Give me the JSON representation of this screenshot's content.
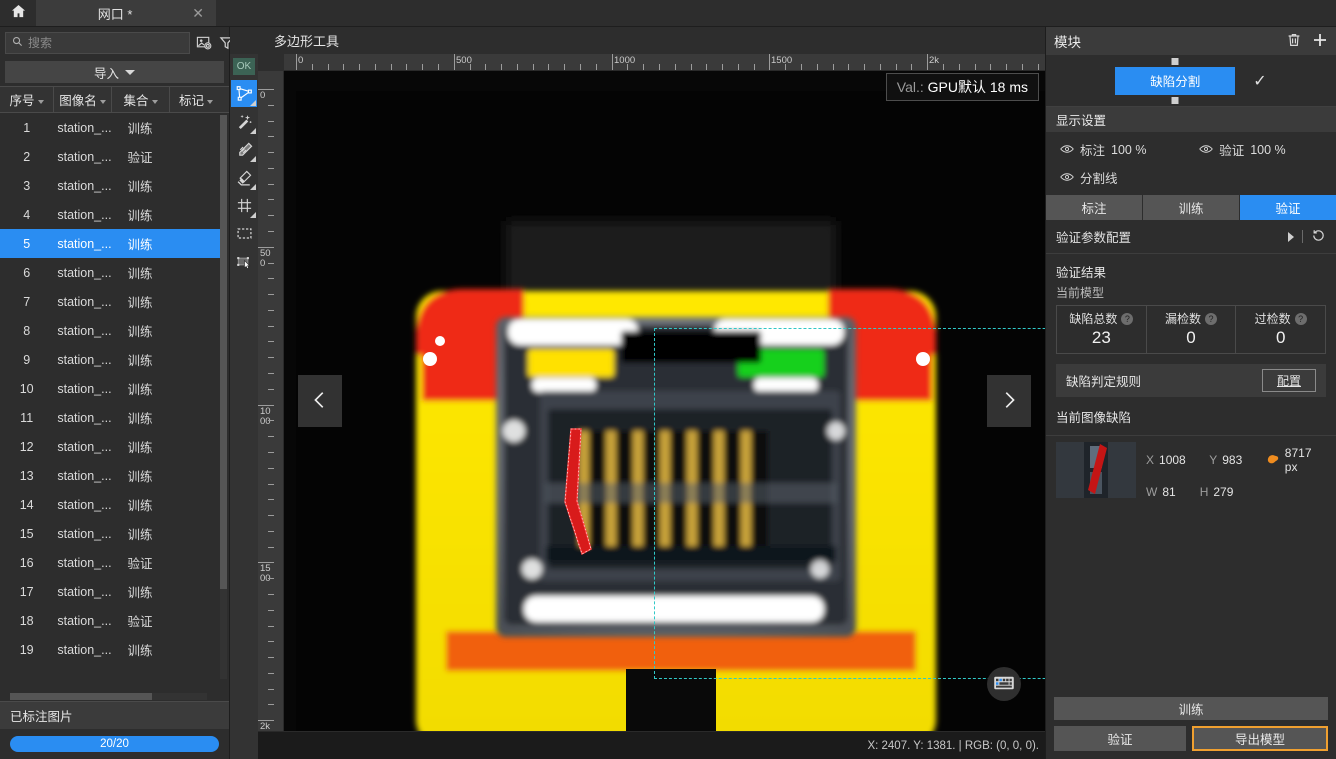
{
  "titlebar": {
    "home_icon": "home-icon",
    "tab_label": "网口 *",
    "tab_close": "✕"
  },
  "left_panel": {
    "search": {
      "placeholder": "搜索",
      "value": ""
    },
    "toolbar_icons": [
      "image-tag-icon",
      "filter-icon",
      "list-view-icon",
      "thumbnail-view-icon"
    ],
    "import_label": "导入",
    "columns": [
      "序号",
      "图像名",
      "集合",
      "标记"
    ],
    "rows": [
      {
        "idx": "1",
        "name": "station_...",
        "set": "训练",
        "mark": ""
      },
      {
        "idx": "2",
        "name": "station_...",
        "set": "验证",
        "mark": ""
      },
      {
        "idx": "3",
        "name": "station_...",
        "set": "训练",
        "mark": ""
      },
      {
        "idx": "4",
        "name": "station_...",
        "set": "训练",
        "mark": ""
      },
      {
        "idx": "5",
        "name": "station_...",
        "set": "训练",
        "mark": ""
      },
      {
        "idx": "6",
        "name": "station_...",
        "set": "训练",
        "mark": ""
      },
      {
        "idx": "7",
        "name": "station_...",
        "set": "训练",
        "mark": ""
      },
      {
        "idx": "8",
        "name": "station_...",
        "set": "训练",
        "mark": ""
      },
      {
        "idx": "9",
        "name": "station_...",
        "set": "训练",
        "mark": ""
      },
      {
        "idx": "10",
        "name": "station_...",
        "set": "训练",
        "mark": ""
      },
      {
        "idx": "11",
        "name": "station_...",
        "set": "训练",
        "mark": ""
      },
      {
        "idx": "12",
        "name": "station_...",
        "set": "训练",
        "mark": ""
      },
      {
        "idx": "13",
        "name": "station_...",
        "set": "训练",
        "mark": ""
      },
      {
        "idx": "14",
        "name": "station_...",
        "set": "训练",
        "mark": ""
      },
      {
        "idx": "15",
        "name": "station_...",
        "set": "训练",
        "mark": ""
      },
      {
        "idx": "16",
        "name": "station_...",
        "set": "验证",
        "mark": ""
      },
      {
        "idx": "17",
        "name": "station_...",
        "set": "训练",
        "mark": ""
      },
      {
        "idx": "18",
        "name": "station_...",
        "set": "验证",
        "mark": ""
      },
      {
        "idx": "19",
        "name": "station_...",
        "set": "训练",
        "mark": ""
      }
    ],
    "selected_row_index": 4,
    "annotated_label": "已标注图片",
    "progress_text": "20/20"
  },
  "center": {
    "title": "多边形工具",
    "ok_badge": "OK",
    "tools": [
      {
        "name": "polygon-tool",
        "active": true
      },
      {
        "name": "magic-wand-tool",
        "active": false
      },
      {
        "name": "brush-fill-tool",
        "active": false
      },
      {
        "name": "eraser-tool",
        "active": false
      },
      {
        "name": "grid-tool",
        "active": false
      },
      {
        "name": "rect-select-tool",
        "active": false
      },
      {
        "name": "move-select-tool",
        "active": false
      }
    ],
    "val_badge_prefix": "Val.:",
    "val_badge_text": "GPU默认 18 ms",
    "prev_arrow": "chevron-left-icon",
    "next_arrow": "chevron-right-icon",
    "keyboard_icon": "keyboard-icon",
    "ruler_top_labels": [
      "0",
      "500",
      "1000",
      "1500",
      "2k"
    ],
    "ruler_left_labels": [
      "0",
      "500",
      "1000",
      "1500",
      "2k"
    ],
    "statusbar": "X: 2407. Y: 1381. | RGB: (0, 0, 0)."
  },
  "right_panel": {
    "header": {
      "title": "模块",
      "delete_icon": "trash-icon",
      "add_icon": "plus-icon"
    },
    "module_chip": "缺陷分割",
    "module_check": "✓",
    "display_settings_title": "显示设置",
    "display": {
      "annot_label": "标注",
      "annot_value": "100 %",
      "verify_label": "验证",
      "verify_value": "100 %",
      "segline_label": "分割线"
    },
    "tabs": [
      {
        "label": "标注",
        "active": false
      },
      {
        "label": "训练",
        "active": false
      },
      {
        "label": "验证",
        "active": true
      }
    ],
    "config_row": {
      "label": "验证参数配置",
      "expand_icon": "triangle-right-icon",
      "reset_icon": "history-reset-icon"
    },
    "results": {
      "title": "验证结果",
      "subtitle": "当前模型",
      "stats": [
        {
          "caption": "缺陷总数",
          "value": "23",
          "help": "?"
        },
        {
          "caption": "漏检数",
          "value": "0",
          "help": "?"
        },
        {
          "caption": "过检数",
          "value": "0",
          "help": "?"
        }
      ]
    },
    "rule": {
      "label": "缺陷判定规则",
      "button": "配置"
    },
    "current_defects_title": "当前图像缺陷",
    "defect": {
      "x_key": "X",
      "x_val": "1008",
      "y_key": "Y",
      "y_val": "983",
      "area_icon": "area-blob-icon",
      "area_val": "8717 px",
      "w_key": "W",
      "w_val": "81",
      "h_key": "H",
      "h_val": "279"
    },
    "footer": {
      "train": "训练",
      "validate": "验证",
      "export": "导出模型"
    }
  },
  "colors": {
    "accent_blue": "#2a8df2",
    "highlight_orange": "#f0a030",
    "panel_bg": "#2d2d2d",
    "selection_cyan": "#30c8c8"
  }
}
